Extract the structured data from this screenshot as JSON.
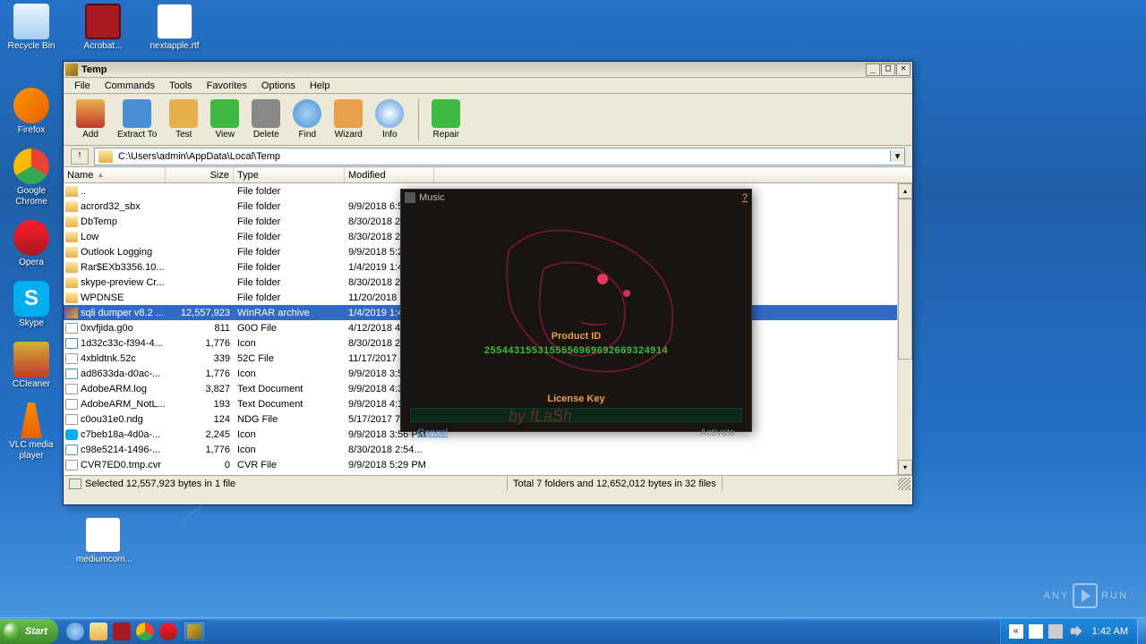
{
  "desktop": {
    "icons": [
      {
        "label": "Recycle Bin",
        "color": "linear-gradient(#e8f4ff, #a8d0f0)"
      },
      {
        "label": "Acrobat...",
        "color": "#a8181f"
      },
      {
        "label": "nextapple.rtf",
        "color": "#4a7ac0"
      },
      {
        "label": "Firefox",
        "color": "linear-gradient(135deg, #ff9500, #e66000)"
      },
      {
        "label": "Google Chrome",
        "color": "conic-gradient(#ea4335 0 120deg, #34a853 120deg 240deg, #fbbc05 240deg)"
      },
      {
        "label": "Opera",
        "color": "linear-gradient(#ff1b2d, #a8181f)"
      },
      {
        "label": "Skype",
        "color": "#00aff0"
      },
      {
        "label": "CCleaner",
        "color": "linear-gradient(#d4af37, #c0392b)"
      },
      {
        "label": "VLC media player",
        "color": "linear-gradient(#ff8c00, #e66000)"
      },
      {
        "label": "mediumcom...",
        "color": "#4a7ac0"
      }
    ]
  },
  "window": {
    "title": "Temp",
    "menus": [
      "File",
      "Commands",
      "Tools",
      "Favorites",
      "Options",
      "Help"
    ],
    "toolbar": [
      {
        "label": "Add",
        "color": "linear-gradient(#e8b04b, #c0392b)"
      },
      {
        "label": "Extract To",
        "color": "#4a90d9"
      },
      {
        "label": "Test",
        "color": "#e8b04b"
      },
      {
        "label": "View",
        "color": "#3eb942"
      },
      {
        "label": "Delete",
        "color": "#888"
      },
      {
        "label": "Find",
        "color": "#4a90d9"
      },
      {
        "label": "Wizard",
        "color": "#e8a04b"
      },
      {
        "label": "Info",
        "color": "#4a90d9"
      },
      {
        "label": "Repair",
        "color": "#3eb942"
      }
    ],
    "address": "C:\\Users\\admin\\AppData\\Local\\Temp",
    "columns": {
      "name": "Name",
      "size": "Size",
      "type": "Type",
      "modified": "Modified"
    },
    "rows": [
      {
        "name": "..",
        "size": "",
        "type": "File folder",
        "mod": "",
        "icon": "folder"
      },
      {
        "name": "acrord32_sbx",
        "size": "",
        "type": "File folder",
        "mod": "9/9/2018 6:51 PM",
        "icon": "folder"
      },
      {
        "name": "DbTemp",
        "size": "",
        "type": "File folder",
        "mod": "8/30/2018 2:54...",
        "icon": "folder"
      },
      {
        "name": "Low",
        "size": "",
        "type": "File folder",
        "mod": "8/30/2018 2:55...",
        "icon": "folder"
      },
      {
        "name": "Outlook Logging",
        "size": "",
        "type": "File folder",
        "mod": "9/9/2018 5:29 PM",
        "icon": "folder"
      },
      {
        "name": "Rar$EXb3356.10...",
        "size": "",
        "type": "File folder",
        "mod": "1/4/2019 1:41 AM",
        "icon": "folder"
      },
      {
        "name": "skype-preview Cr...",
        "size": "",
        "type": "File folder",
        "mod": "8/30/2018 2:54...",
        "icon": "folder"
      },
      {
        "name": "WPDNSE",
        "size": "",
        "type": "File folder",
        "mod": "11/20/2018 7:1...",
        "icon": "folder"
      },
      {
        "name": "sqli dumper v8.2 ...",
        "size": "12,557,923",
        "type": "WinRAR archive",
        "mod": "1/4/2019 1:41 AM",
        "icon": "rar",
        "selected": true
      },
      {
        "name": "0xvfjida.g0o",
        "size": "811",
        "type": "G0O File",
        "mod": "4/12/2018 4:19...",
        "icon": "file"
      },
      {
        "name": "1d32c33c-f394-4...",
        "size": "1,776",
        "type": "Icon",
        "mod": "8/30/2018 2:55...",
        "icon": "icon"
      },
      {
        "name": "4xbldtnk.52c",
        "size": "339",
        "type": "52C File",
        "mod": "11/17/2017 4:1...",
        "icon": "file"
      },
      {
        "name": "ad8633da-d0ac-...",
        "size": "1,776",
        "type": "Icon",
        "mod": "9/9/2018 3:55 PM",
        "icon": "icon"
      },
      {
        "name": "AdobeARM.log",
        "size": "3,827",
        "type": "Text Document",
        "mod": "9/9/2018 4:35 PM",
        "icon": "file"
      },
      {
        "name": "AdobeARM_NotL...",
        "size": "193",
        "type": "Text Document",
        "mod": "9/9/2018 4:11...",
        "icon": "file"
      },
      {
        "name": "c0ou31e0.ndg",
        "size": "124",
        "type": "NDG File",
        "mod": "5/17/2017 7:16...",
        "icon": "file"
      },
      {
        "name": "c7beb18a-4d0a-...",
        "size": "2,245",
        "type": "Icon",
        "mod": "9/9/2018 3:56 PM",
        "icon": "skype"
      },
      {
        "name": "c98e5214-1496-...",
        "size": "1,776",
        "type": "Icon",
        "mod": "8/30/2018 2:54...",
        "icon": "icon"
      },
      {
        "name": "CVR7ED0.tmp.cvr",
        "size": "0",
        "type": "CVR File",
        "mod": "9/9/2018 5:29 PM",
        "icon": "file"
      }
    ],
    "status_left": "Selected 12,557,923 bytes in 1 file",
    "status_right": "Total 7 folders and 12,652,012 bytes in 32 files"
  },
  "dialog": {
    "title": "Music",
    "help": "?",
    "label1": "Product ID",
    "value": "25544315531555569696926693249​14",
    "label2": "License Key",
    "cancel": "Cancel",
    "activate": "Activate",
    "flash": "by fLaSh"
  },
  "taskbar": {
    "start": "Start",
    "clock": "1:42 AM"
  },
  "watermark": {
    "a": "ANY",
    "b": "RUN"
  }
}
